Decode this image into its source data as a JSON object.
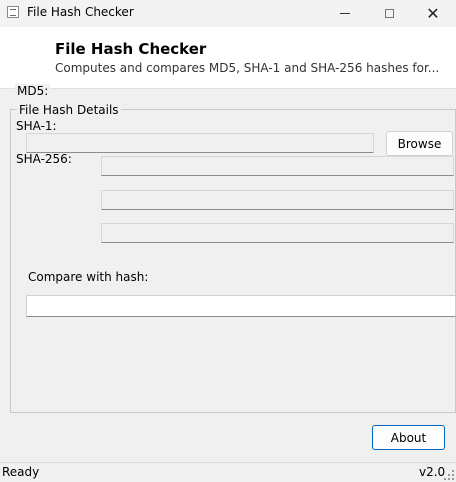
{
  "window": {
    "title": "File Hash Checker",
    "icon": "app-icon"
  },
  "header": {
    "title": "File Hash Checker",
    "subtitle": "Computes and compares MD5, SHA-1 and SHA-256 hashes for..."
  },
  "group": {
    "legend": "File Hash Details"
  },
  "labels": {
    "md5": "MD5:",
    "sha1": "SHA-1:",
    "sha256": "SHA-256:",
    "compare": "Compare with hash:"
  },
  "fields": {
    "file_path": "",
    "sha1_value": "",
    "sha256_value": "",
    "md5_value": "",
    "compare_value": ""
  },
  "buttons": {
    "browse": "Browse",
    "about": "About"
  },
  "status": {
    "text": "Ready",
    "version": "v2.0"
  },
  "colors": {
    "accent": "#0067c0",
    "background": "#f0f0f0",
    "header_background": "#ffffff"
  }
}
